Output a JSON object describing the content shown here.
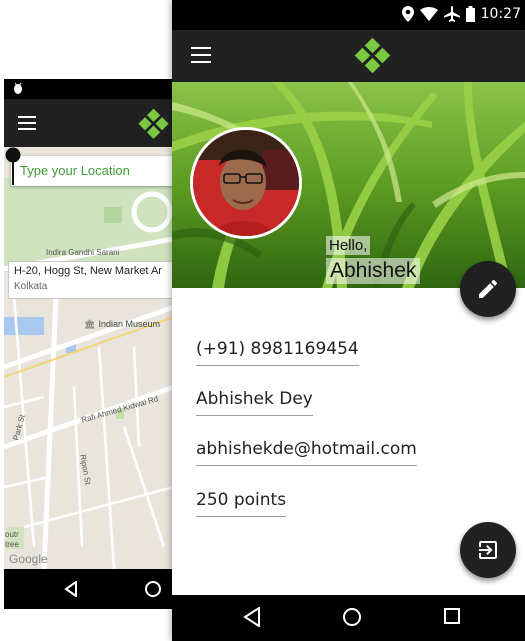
{
  "colors": {
    "toolbar": "#212121",
    "accent_green": "#3f9c35",
    "logo_green": "#7ac943",
    "fab": "#212121"
  },
  "back_screen": {
    "location_input": {
      "placeholder": "Type your Location"
    },
    "address_card": {
      "line1": "H-20, Hogg St, New Market Ar",
      "line2": "Kolkata"
    },
    "map_labels": {
      "indira": "Indira Gandhi Sarani",
      "museum": "Indian Museum",
      "rafi": "Rafi Ahmed Kidwai Rd",
      "park": "Park St",
      "ripon": "Ripon St",
      "google": "Google",
      "out": "outr",
      "tree": "tree"
    },
    "icons": [
      "android-debug-icon",
      "menu-icon",
      "app-logo-icon",
      "gift-icon",
      "plus-icon",
      "back-icon",
      "home-icon"
    ]
  },
  "profile": {
    "status_time": "10:27",
    "greeting": "Hello,",
    "name": "Abhishek",
    "phone": "(+91) 8981169454",
    "full_name": "Abhishek Dey",
    "email": "abhishekde@hotmail.com",
    "points": "250 points",
    "icons": [
      "location-icon",
      "wifi-icon",
      "airplane-icon",
      "battery-icon",
      "menu-icon",
      "app-logo-icon",
      "edit-pencil-icon",
      "exit-icon",
      "back-icon",
      "home-icon",
      "recents-icon"
    ]
  }
}
